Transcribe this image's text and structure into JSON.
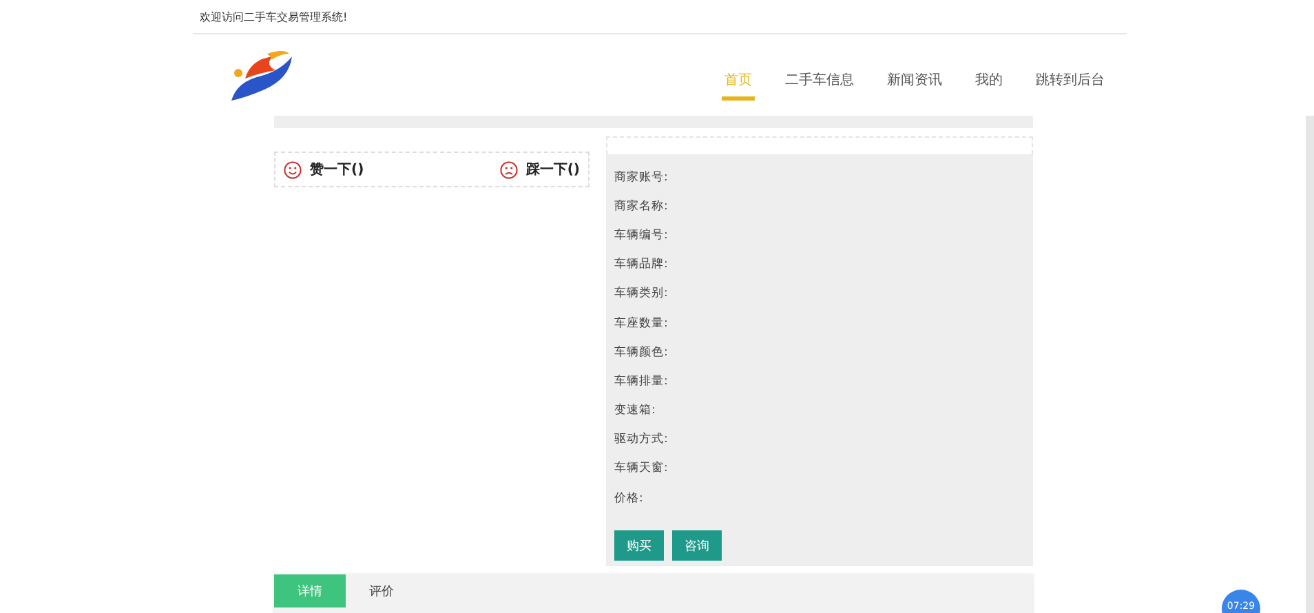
{
  "top_bar": {
    "welcome": "欢迎访问二手车交易管理系统!"
  },
  "nav": {
    "items": [
      {
        "label": "首页",
        "selected": true
      },
      {
        "label": "二手车信息",
        "selected": false
      },
      {
        "label": "新闻资讯",
        "selected": false
      },
      {
        "label": "我的",
        "selected": false
      },
      {
        "label": "跳转到后台",
        "selected": false
      }
    ]
  },
  "reactions": [
    {
      "kind": "like",
      "label": "赞一下()"
    },
    {
      "kind": "dislike",
      "label": "踩一下()"
    }
  ],
  "details": {
    "fields": [
      "商家账号:",
      "商家名称:",
      "车辆编号:",
      "车辆品牌:",
      "车辆类别:",
      "车座数量:",
      "车辆颜色:",
      "车辆排量:",
      "变速箱:",
      "驱动方式:",
      "车辆天窗:",
      "价格:"
    ],
    "buttons": [
      "购买",
      "咨询"
    ]
  },
  "tabs": [
    {
      "label": "详情",
      "selected": true
    },
    {
      "label": "评价",
      "selected": false
    }
  ],
  "timer": "07:29"
}
